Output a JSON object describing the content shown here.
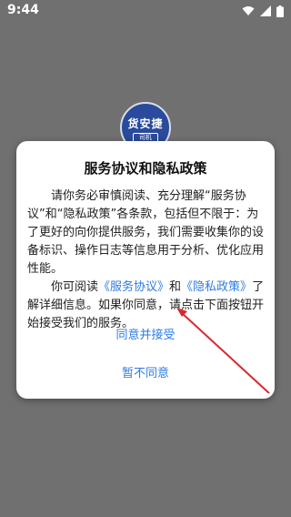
{
  "status_bar": {
    "time": "9:44"
  },
  "logo": {
    "line1": "货安捷",
    "line2": "司机"
  },
  "dialog": {
    "title": "服务协议和隐私政策",
    "p1": "请你务必审慎阅读、充分理解“服务协议”和“隐私政策”各条款，包括但不限于：为了更好的向你提供服务，我们需要收集你的设备标识、操作日志等信息用于分析、优化应用性能。",
    "p2_prefix": "你可阅读",
    "link_service": "《服务协议》",
    "p2_and": "和",
    "link_privacy": "《隐私政策》",
    "p2_suffix": "了解详细信息。如果你同意，请点击下面按钮开始接受我们的服务。",
    "accept_label": "同意并接受",
    "decline_label": "暂不同意"
  },
  "colors": {
    "accent": "#2e7be6",
    "overlay": "#707070",
    "arrow": "#d8292f"
  }
}
